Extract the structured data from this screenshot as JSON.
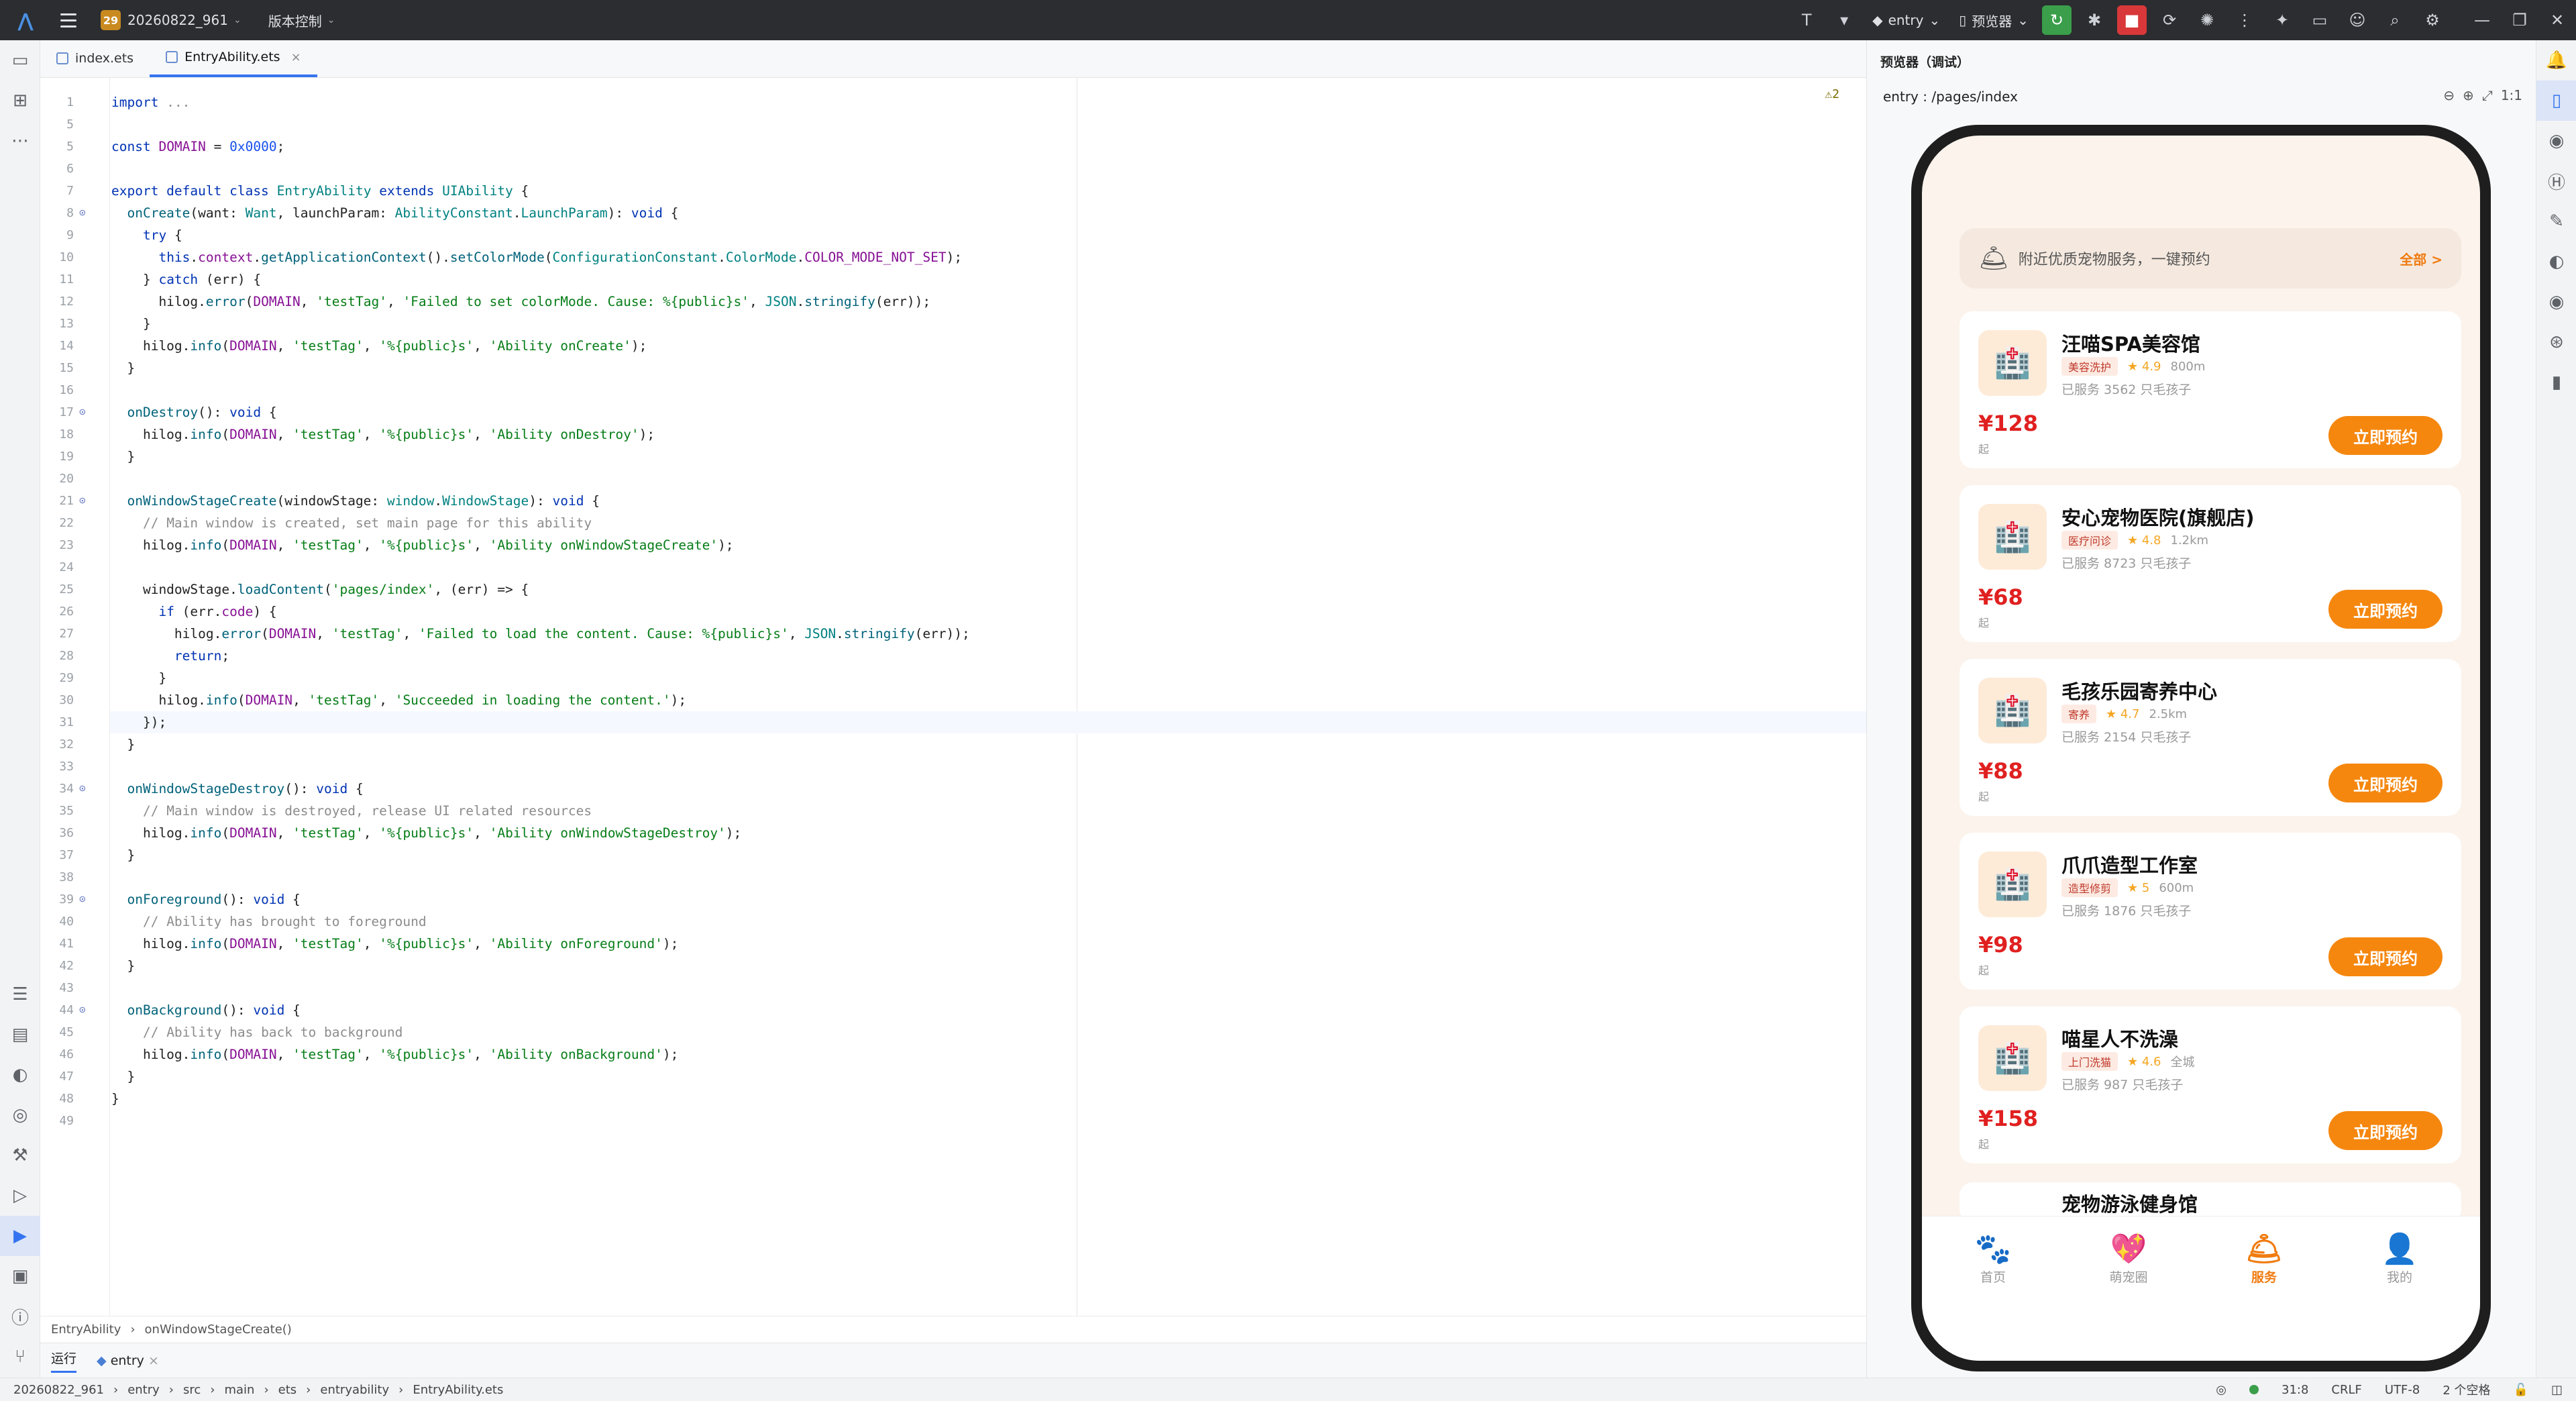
{
  "titlebar": {
    "project_badge": "29",
    "project_name": "20260822_961",
    "vcs": "版本控制",
    "run_config": "entry",
    "previewer": "预览器"
  },
  "tabs": [
    {
      "label": "index.ets"
    },
    {
      "label": "EntryAbility.ets"
    }
  ],
  "editor": {
    "warnings": "⚠2"
  },
  "breadcrumb": {
    "class": "EntryAbility",
    "method": "onWindowStageCreate()"
  },
  "run_bar": {
    "run": "运行",
    "config": "entry"
  },
  "status": {
    "crumbs": [
      "20260822_961",
      "entry",
      "src",
      "main",
      "ets",
      "entryability",
      "EntryAbility.ets"
    ],
    "position": "31:8",
    "line_sep": "CRLF",
    "encoding": "UTF-8",
    "indent": "2 个空格"
  },
  "preview": {
    "title": "预览器（调试）",
    "path": "entry : /pages/index",
    "banner": "附近优质宠物服务，一键预约",
    "banner_all": "全部 >",
    "cards": [
      {
        "name": "汪喵SPA美容馆",
        "tag": "美容洗护",
        "rating": "4.9",
        "distance": "800m",
        "served": "已服务 3562 只毛孩子",
        "price": "¥128",
        "unit": "起",
        "button": "立即预约"
      },
      {
        "name": "安心宠物医院(旗舰店)",
        "tag": "医疗问诊",
        "rating": "4.8",
        "distance": "1.2km",
        "served": "已服务 8723 只毛孩子",
        "price": "¥68",
        "unit": "起",
        "button": "立即预约"
      },
      {
        "name": "毛孩乐园寄养中心",
        "tag": "寄养",
        "rating": "4.7",
        "distance": "2.5km",
        "served": "已服务 2154 只毛孩子",
        "price": "¥88",
        "unit": "起",
        "button": "立即预约"
      },
      {
        "name": "爪爪造型工作室",
        "tag": "造型修剪",
        "rating": "5",
        "distance": "600m",
        "served": "已服务 1876 只毛孩子",
        "price": "¥98",
        "unit": "起",
        "button": "立即预约"
      },
      {
        "name": "喵星人不洗澡",
        "tag": "上门洗猫",
        "rating": "4.6",
        "distance": "全城",
        "served": "已服务 987 只毛孩子",
        "price": "¥158",
        "unit": "起",
        "button": "立即预约"
      }
    ],
    "partial_card": "宠物游泳健身馆",
    "tabbar": [
      {
        "label": "首页"
      },
      {
        "label": "萌宠圈"
      },
      {
        "label": "服务"
      },
      {
        "label": "我的"
      }
    ]
  }
}
